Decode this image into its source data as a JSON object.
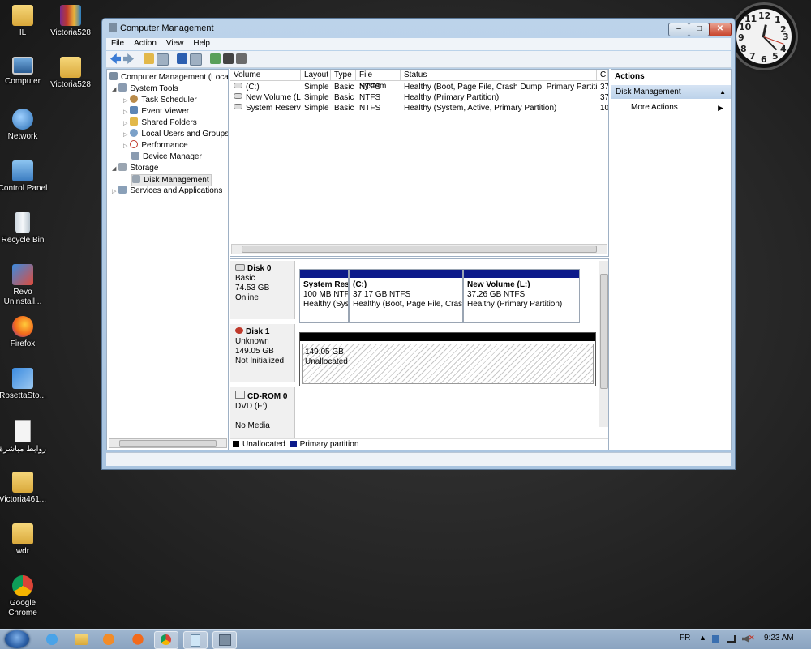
{
  "desktop": {
    "icons": [
      {
        "label": "IL",
        "icon": "folder-icon"
      },
      {
        "label": "Victoria528",
        "icon": "winrar-icon"
      },
      {
        "label": "Computer",
        "icon": "computer-icon"
      },
      {
        "label": "Victoria528",
        "icon": "folder-icon"
      },
      {
        "label": "Network",
        "icon": "network-icon"
      },
      {
        "label": "Control Panel",
        "icon": "control-panel-icon"
      },
      {
        "label": "Recycle Bin",
        "icon": "recycle-bin-icon"
      },
      {
        "label": "Revo Uninstall...",
        "icon": "revo-icon"
      },
      {
        "label": "Firefox",
        "icon": "firefox-icon"
      },
      {
        "label": "RosettaSto...",
        "icon": "rosetta-icon"
      },
      {
        "label": "روابط مباشرة",
        "icon": "document-icon"
      },
      {
        "label": "Victoria461...",
        "icon": "folder-icon"
      },
      {
        "label": "wdr",
        "icon": "folder-icon"
      },
      {
        "label": "Google Chrome",
        "icon": "chrome-icon"
      }
    ]
  },
  "clock": {
    "numbers": [
      "12",
      "1",
      "2",
      "3",
      "4",
      "5",
      "6",
      "7",
      "8",
      "9",
      "10",
      "11"
    ],
    "display_time": "9:23"
  },
  "window": {
    "title": "Computer Management",
    "controls": {
      "minimize": "‒",
      "maximize": "□",
      "close": "✕"
    },
    "menu": [
      "File",
      "Action",
      "View",
      "Help"
    ],
    "tree": {
      "root": "Computer Management (Local",
      "items": [
        {
          "label": "System Tools",
          "level": 1,
          "expander": "◢"
        },
        {
          "label": "Task Scheduler",
          "level": 2,
          "expander": "▷"
        },
        {
          "label": "Event Viewer",
          "level": 2,
          "expander": "▷"
        },
        {
          "label": "Shared Folders",
          "level": 2,
          "expander": "▷"
        },
        {
          "label": "Local Users and Groups",
          "level": 2,
          "expander": "▷"
        },
        {
          "label": "Performance",
          "level": 2,
          "expander": "▷"
        },
        {
          "label": "Device Manager",
          "level": 2,
          "expander": ""
        },
        {
          "label": "Storage",
          "level": 1,
          "expander": "◢"
        },
        {
          "label": "Disk Management",
          "level": 2,
          "expander": ""
        },
        {
          "label": "Services and Applications",
          "level": 1,
          "expander": "▷"
        }
      ]
    },
    "volume_table": {
      "columns": [
        "Volume",
        "Layout",
        "Type",
        "File System",
        "Status",
        "C"
      ],
      "rows": [
        [
          "(C:)",
          "Simple",
          "Basic",
          "NTFS",
          "Healthy (Boot, Page File, Crash Dump, Primary Partition)",
          "37"
        ],
        [
          "New Volume (L:)",
          "Simple",
          "Basic",
          "NTFS",
          "Healthy (Primary Partition)",
          "37"
        ],
        [
          "System Reserved",
          "Simple",
          "Basic",
          "NTFS",
          "Healthy (System, Active, Primary Partition)",
          "10"
        ]
      ]
    },
    "disks": [
      {
        "name": "Disk 0",
        "type": "Basic",
        "size": "74.53 GB",
        "state": "Online",
        "partitions": [
          {
            "name": "System Res",
            "size": "100 MB NTF",
            "status": "Healthy (Sys"
          },
          {
            "name": "(C:)",
            "size": "37.17 GB NTFS",
            "status": "Healthy (Boot, Page File, Crash"
          },
          {
            "name": "New Volume  (L:)",
            "size": "37.26 GB NTFS",
            "status": "Healthy (Primary Partition)"
          }
        ]
      },
      {
        "name": "Disk 1",
        "type": "Unknown",
        "size": "149.05 GB",
        "state": "Not Initialized",
        "partitions": [
          {
            "name": "",
            "size": "149.05 GB",
            "status": "Unallocated"
          }
        ]
      },
      {
        "name": "CD-ROM 0",
        "type": "DVD (F:)",
        "size": "",
        "state": "No Media",
        "partitions": []
      }
    ],
    "legend": [
      {
        "label": "Unallocated",
        "color": "#000000"
      },
      {
        "label": "Primary partition",
        "color": "#0c1a8a"
      }
    ],
    "actions": {
      "header": "Actions",
      "section": "Disk Management",
      "items": [
        "More Actions"
      ]
    }
  },
  "taskbar": {
    "language": "FR",
    "time": "9:23 AM",
    "pinned": [
      "ie-icon",
      "explorer-icon",
      "media-player-icon",
      "firefox-icon",
      "chrome-icon",
      "notepad-icon",
      "computer-management-icon"
    ]
  }
}
